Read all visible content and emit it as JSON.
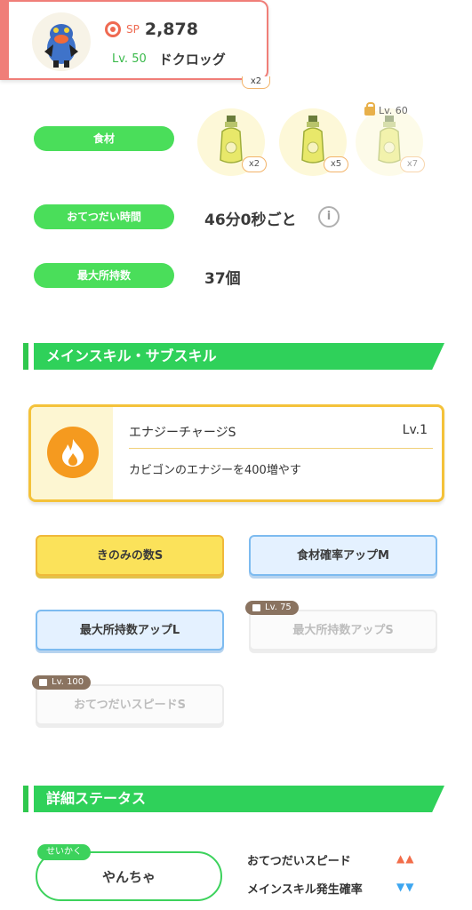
{
  "header_card": {
    "sp_label": "SP",
    "sp_value": "2,878",
    "level": "Lv. 50",
    "name": "ドクロッグ",
    "peek_badge": "x2"
  },
  "ingredients": {
    "label": "食材",
    "items": [
      {
        "icon": "oil-bottle-icon",
        "count": "x2",
        "locked": false
      },
      {
        "icon": "oil-bottle-icon",
        "count": "x5",
        "locked": false
      },
      {
        "icon": "oil-bottle-icon",
        "count": "x7",
        "locked": true,
        "unlock_level": "Lv. 60"
      }
    ]
  },
  "help_time": {
    "label": "おてつだい時間",
    "value": "46分0秒ごと",
    "info": "i"
  },
  "max_carry": {
    "label": "最大所持数",
    "value": "37個"
  },
  "skills_section": {
    "title": "メインスキル・サブスキル"
  },
  "main_skill": {
    "name": "エナジーチャージS",
    "level": "Lv.1",
    "description": "カビゴンのエナジーを400増やす",
    "icon": "flame-icon"
  },
  "sub_skills": [
    {
      "label": "きのみの数S",
      "style": "gold",
      "locked": false
    },
    {
      "label": "食材確率アップM",
      "style": "blue",
      "locked": false
    },
    {
      "label": "最大所持数アップL",
      "style": "blue",
      "locked": false
    },
    {
      "label": "最大所持数アップS",
      "style": "grey",
      "locked": true,
      "unlock_level": "Lv. 75"
    },
    {
      "label": "おてつだいスピードS",
      "style": "grey",
      "locked": true,
      "unlock_level": "Lv. 100"
    }
  ],
  "details_section": {
    "title": "詳細ステータス"
  },
  "nature": {
    "tag": "せいかく",
    "value": "やんちゃ",
    "effects": [
      {
        "label": "おてつだいスピード",
        "arrows": "▲▲",
        "direction": "up"
      },
      {
        "label": "メインスキル発生確率",
        "arrows": "▼▼",
        "direction": "down"
      }
    ]
  },
  "colors": {
    "accent_green": "#2fd15a",
    "header_red": "#f07e78",
    "gold": "#fbe25a",
    "blue": "#e4f1ff"
  }
}
